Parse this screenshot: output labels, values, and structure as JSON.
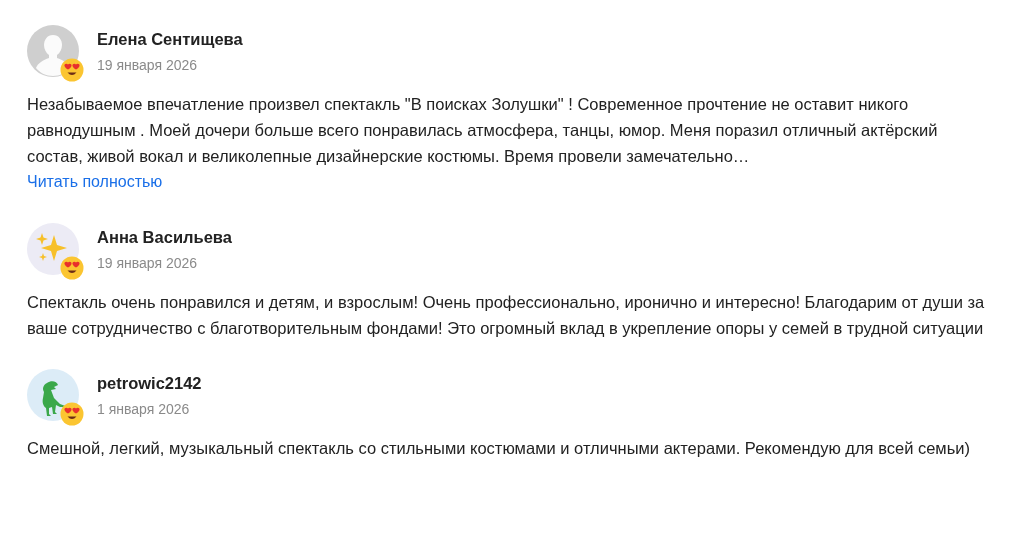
{
  "reviews": [
    {
      "author": "Елена Сентищева",
      "avatar": {
        "kind": "silhouette"
      },
      "date": "19 января 2026",
      "text": "Незабываемое впечатление произвел спектакль \"В поисках Золушки\" ! Современное прочтение не оставит никого равнодушным . Моей дочери больше всего понравилась атмосфера, танцы, юмор. Меня поразил отличный актёрский состав, живой вокал и великолепные дизайнерские костюмы. Время провели замечательно…",
      "more_link": "Читать полностью"
    },
    {
      "author": "Анна Васильева",
      "avatar": {
        "kind": "sparkles"
      },
      "date": "19 января 2026",
      "text": "Спектакль очень понравился и детям, и взрослым! Очень профессионально, иронично и интересно! Благодарим от души за ваше сотрудничество с благотворительным фондами! Это огромный вклад в укрепление опоры у семей в трудной ситуации"
    },
    {
      "author": "petrowic2142",
      "avatar": {
        "kind": "dinosaur"
      },
      "date": "1 января 2026",
      "text": "Смешной, легкий, музыкальный спектакль со стильными костюмами и отличными актерами. Рекомендую для всей семьи)"
    }
  ]
}
